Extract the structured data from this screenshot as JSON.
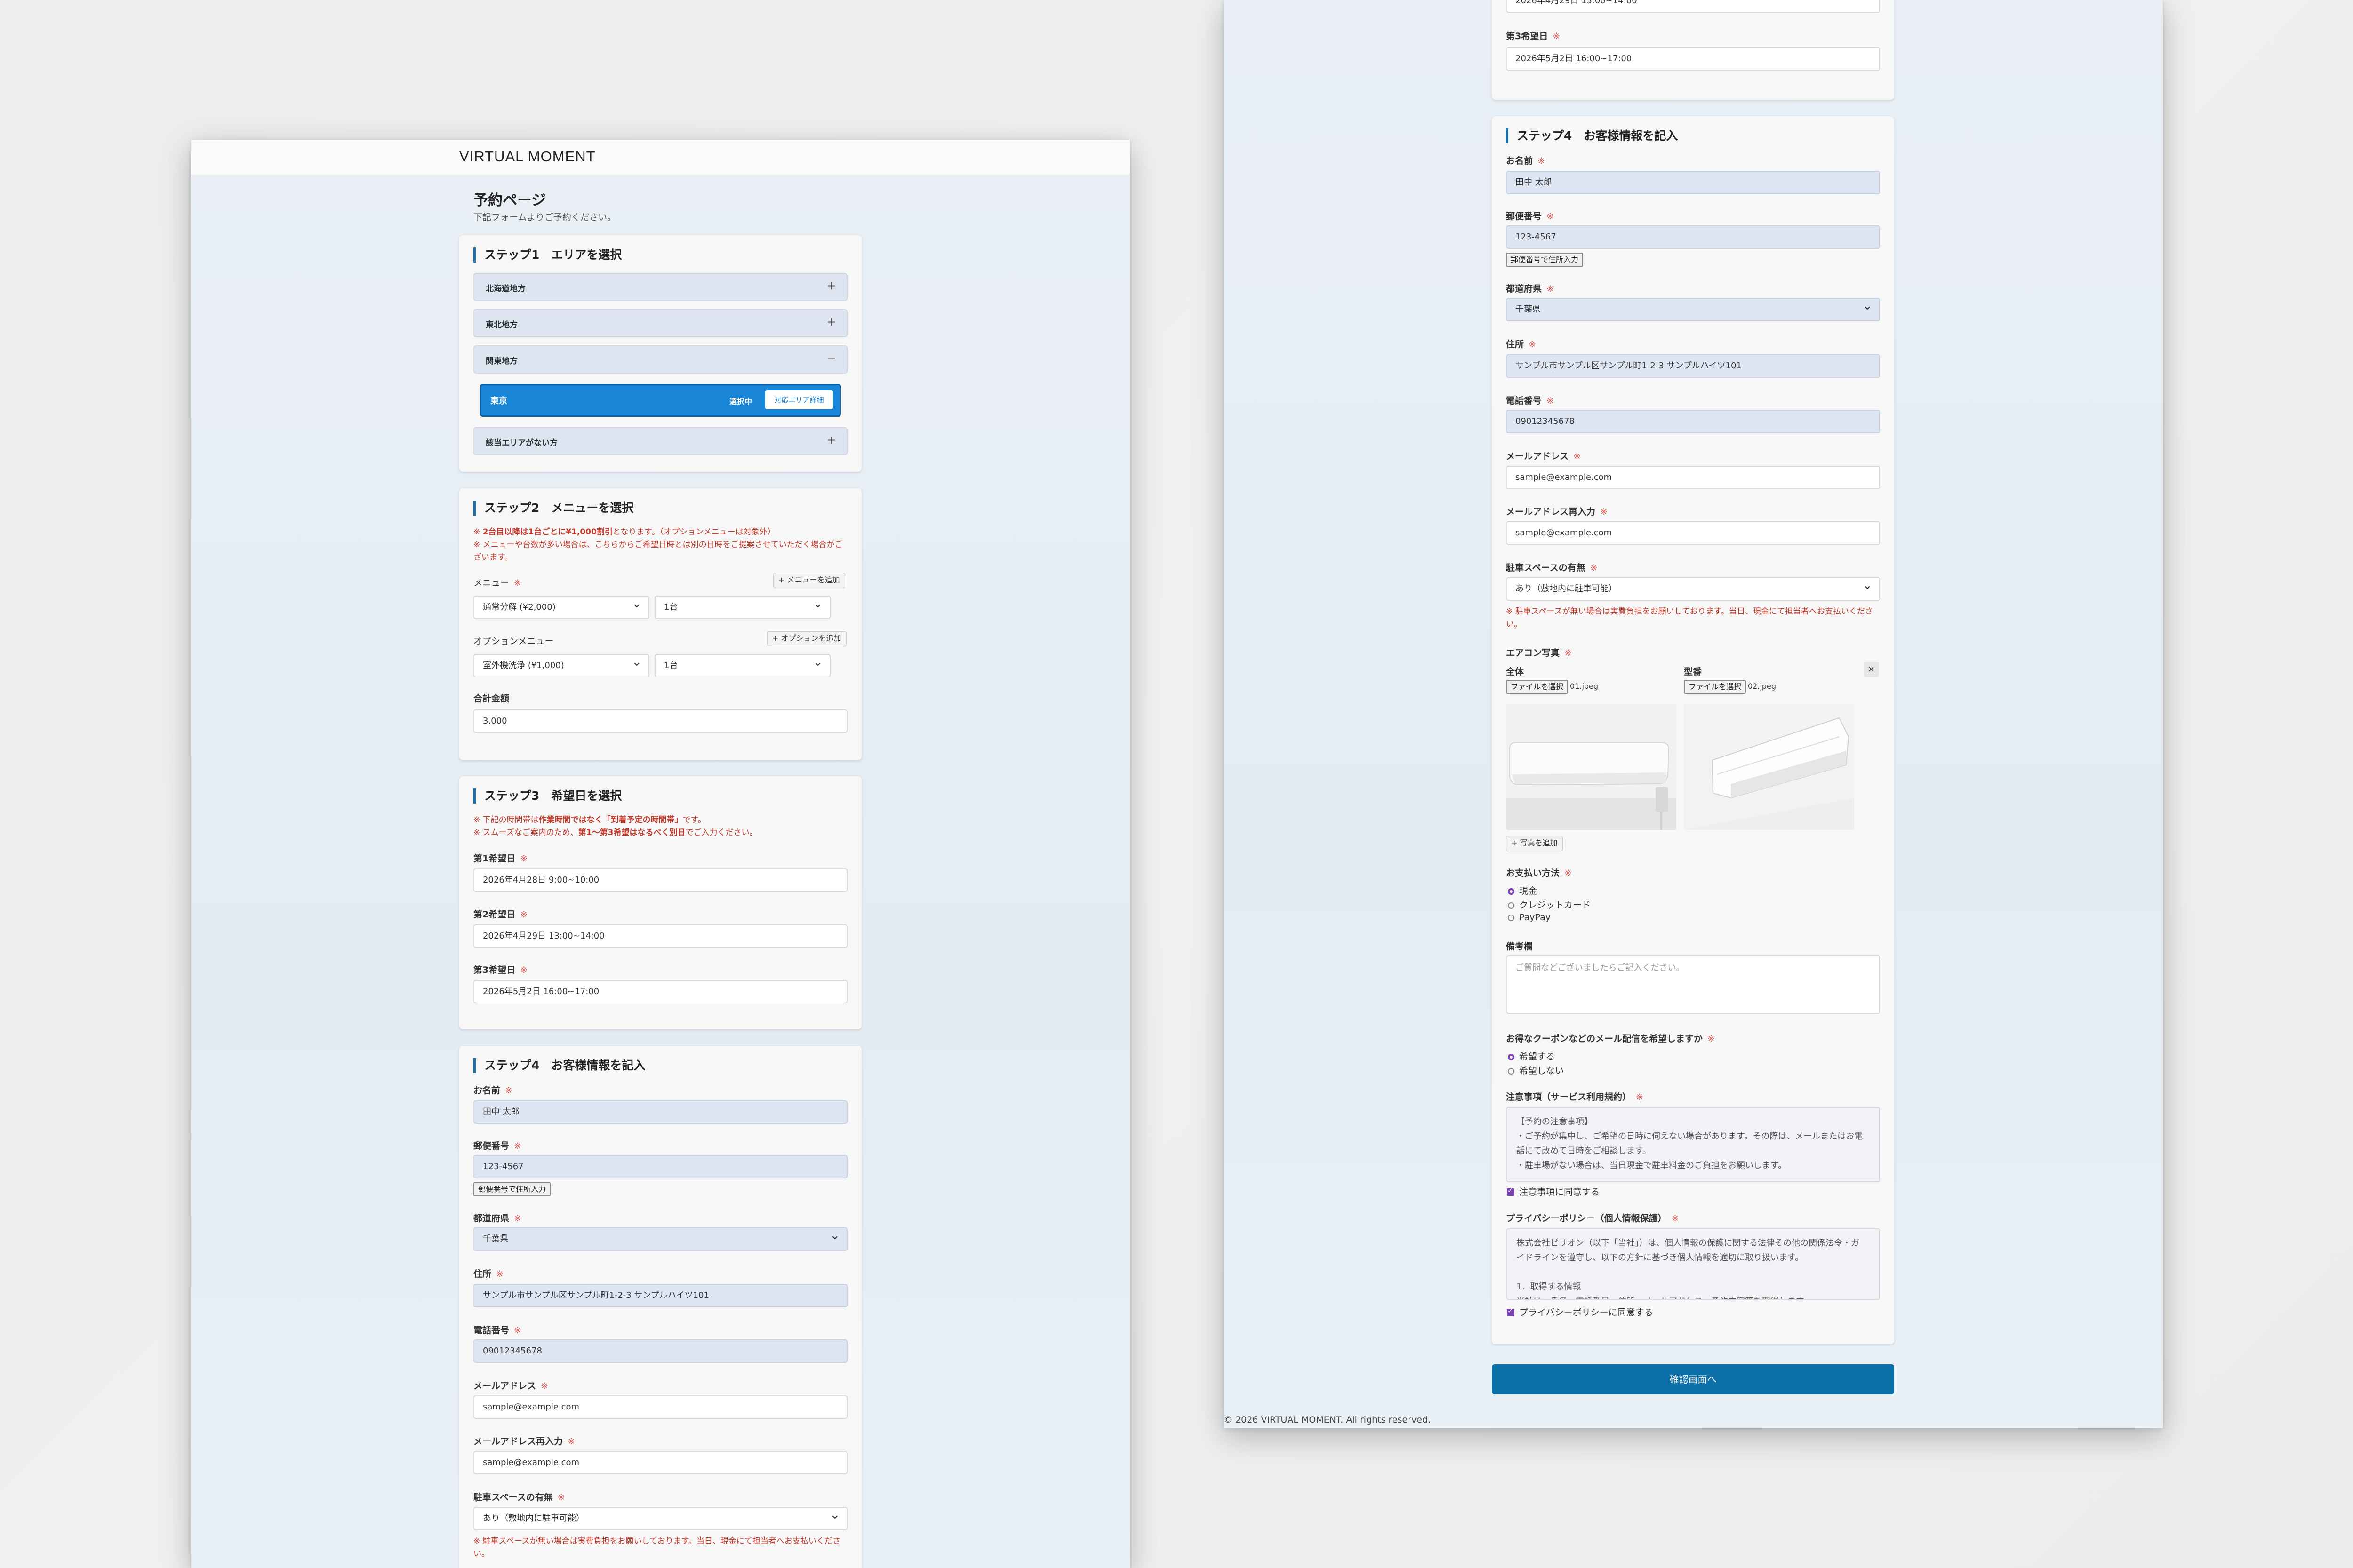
{
  "brand": "VIRTUAL MOMENT",
  "page": {
    "title": "予約ページ",
    "subtitle": "下記フォームよりご予約ください。"
  },
  "req_mark": "※",
  "step1": {
    "heading": "ステップ1　エリアを選択",
    "regions": [
      {
        "label": "北海道地方",
        "symbol": "+"
      },
      {
        "label": "東北地方",
        "symbol": "+"
      },
      {
        "label": "関東地方",
        "symbol": "−"
      }
    ],
    "selected": {
      "label": "東京",
      "status": "選択中",
      "detail_button": "対応エリア詳細"
    },
    "no_area": {
      "label": "該当エリアがない方",
      "symbol": "+"
    }
  },
  "step2": {
    "heading": "ステップ2　メニューを選択",
    "note_1a": "※ ",
    "note_1b": "2台目以降は1台ごとに¥1,000割引",
    "note_1c": "となります。（オプションメニューは対象外）",
    "note_2": "※ メニューや台数が多い場合は、こちらからご希望日時とは別の日時をご提案させていただく場合がございます。",
    "menu_label": "メニュー",
    "add_menu": "+ メニューを追加",
    "menu_value": "通常分解 (¥2,000)",
    "menu_qty": "1台",
    "option_label": "オプションメニュー",
    "add_option": "+ オプションを追加",
    "option_value": "室外機洗浄 (¥1,000)",
    "option_qty": "1台",
    "total_label": "合計金額",
    "total_value": "3,000"
  },
  "step3": {
    "heading": "ステップ3　希望日を選択",
    "note_1a": "※ 下記の時間帯は",
    "note_1b": "作業時間ではなく「到着予定の時間帯」",
    "note_1c": "です。",
    "note_2a": "※ スムーズなご案内のため、",
    "note_2b": "第1〜第3希望はなるべく別日",
    "note_2c": "でご入力ください。",
    "dates": [
      {
        "label": "第1希望日",
        "value": "2026年4月28日 9:00~10:00"
      },
      {
        "label": "第2希望日",
        "value": "2026年4月29日 13:00~14:00"
      },
      {
        "label": "第3希望日",
        "value": "2026年5月2日 16:00~17:00"
      }
    ]
  },
  "step4": {
    "heading": "ステップ4　お客様情報を記入",
    "name_label": "お名前",
    "name_value": "田中 太郎",
    "zip_label": "郵便番号",
    "zip_value": "123-4567",
    "zip_button": "郵便番号で住所入力",
    "pref_label": "都道府県",
    "pref_value": "千葉県",
    "address_label": "住所",
    "address_value": "サンプル市サンプル区サンプル町1-2-3 サンプルハイツ101",
    "phone_label": "電話番号",
    "phone_value": "09012345678",
    "email_label": "メールアドレス",
    "email_value": "sample@example.com",
    "email2_label": "メールアドレス再入力",
    "email2_value": "sample@example.com",
    "parking_label": "駐車スペースの有無",
    "parking_value": "あり（敷地内に駐車可能）",
    "parking_note": "※ 駐車スペースが無い場合は実費負担をお願いしております。当日、現金にて担当者へお支払いください。",
    "photo_label": "エアコン写真",
    "photo_whole": "全体",
    "photo_model": "型番",
    "file_button": "ファイルを選択",
    "file1": "01.jpeg",
    "file2": "02.jpeg",
    "remove": "×",
    "add_photo": "+ 写真を追加",
    "pay_label": "お支払い方法",
    "pay_options": [
      "現金",
      "クレジットカード",
      "PayPay"
    ],
    "memo_label": "備考欄",
    "memo_placeholder": "ご質問などございましたらご記入ください。",
    "coupon_label": "お得なクーポンなどのメール配信を希望しますか",
    "coupon_options": [
      "希望する",
      "希望しない"
    ],
    "terms_label": "注意事項（サービス利用規約）",
    "terms_lines": [
      "【予約の注意事項】",
      "・ご予約が集中し、ご希望の日時に伺えない場合があります。その際は、メールまたはお電",
      "話にて改めて日時をご相談します。",
      "・駐車場がない場合は、当日現金で駐車料金のご負担をお願いします。"
    ],
    "terms_agree": "注意事項に同意する",
    "privacy_label": "プライバシーポリシー（個人情報保護）",
    "privacy_lines": [
      "株式会社ピリオン（以下「当社」）は、個人情報の保護に関する法律その他の関係法令・ガ",
      "イドラインを遵守し、以下の方針に基づき個人情報を適切に取り扱います。",
      "",
      "1．取得する情報",
      "当社は、氏名、電話番号、住所、メールアドレス、予約内容等を取得します。"
    ],
    "privacy_agree": "プライバシーポリシーに同意する"
  },
  "submit": "確認画面へ",
  "footer": "© 2026 VIRTUAL MOMENT. All rights reserved.",
  "colors": {
    "accent": "#0d71a9",
    "required": "#d9534f",
    "selected_area": "#1a86d8",
    "checkbox": "#7a3fb0"
  }
}
